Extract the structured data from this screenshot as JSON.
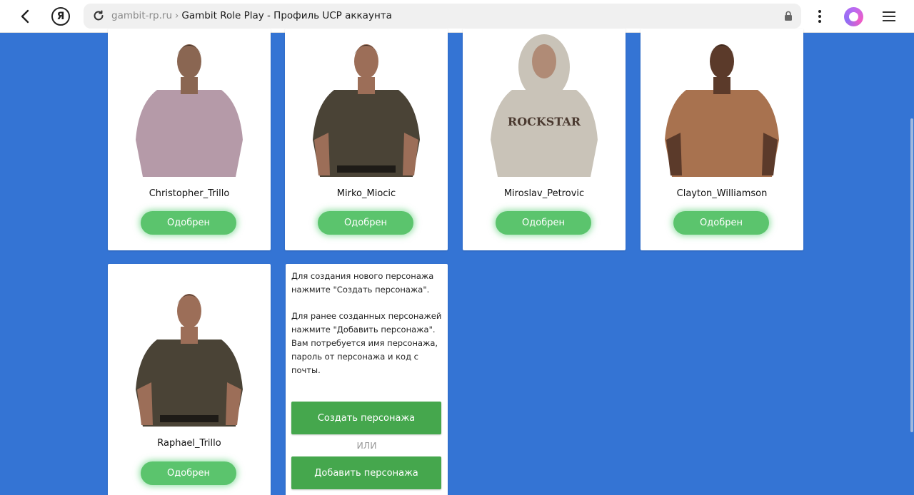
{
  "browser": {
    "domain": "gambit-rp.ru",
    "separator": "›",
    "page_title": "Gambit Role Play - Профиль UCP аккаунта"
  },
  "characters": [
    {
      "name": "Christopher_Trillo",
      "status": "Одобрен",
      "shirt": "#b59aa8",
      "skin": "#8a6652"
    },
    {
      "name": "Mirko_Miocic",
      "status": "Одобрен",
      "shirt": "#4a4336",
      "skin": "#9c6e58"
    },
    {
      "name": "Miroslav_Petrovic",
      "status": "Одобрен",
      "shirt": "#c9c3b8",
      "skin": "#b08b76",
      "print": "ROCKSTAR"
    },
    {
      "name": "Clayton_Williamson",
      "status": "Одобрен",
      "shirt": "#a8724f",
      "skin": "#5b3a2a"
    },
    {
      "name": "Raphael_Trillo",
      "status": "Одобрен",
      "shirt": "#4a4336",
      "skin": "#9c6e58"
    }
  ],
  "info": {
    "paragraph1": "Для создания нового персонажа нажмите \"Создать персонажа\".",
    "paragraph2": "Для ранее созданных персонажей нажмите \"Добавить персонажа\". Вам потребуется имя персонажа, пароль от персонажа и код с почты.",
    "create_label": "Создать персонажа",
    "or_label": "ИЛИ",
    "add_label": "Добавить персонажа"
  },
  "colors": {
    "page_bg": "#3474d4",
    "status_green": "#5bc46d",
    "action_green": "#45a74d"
  }
}
